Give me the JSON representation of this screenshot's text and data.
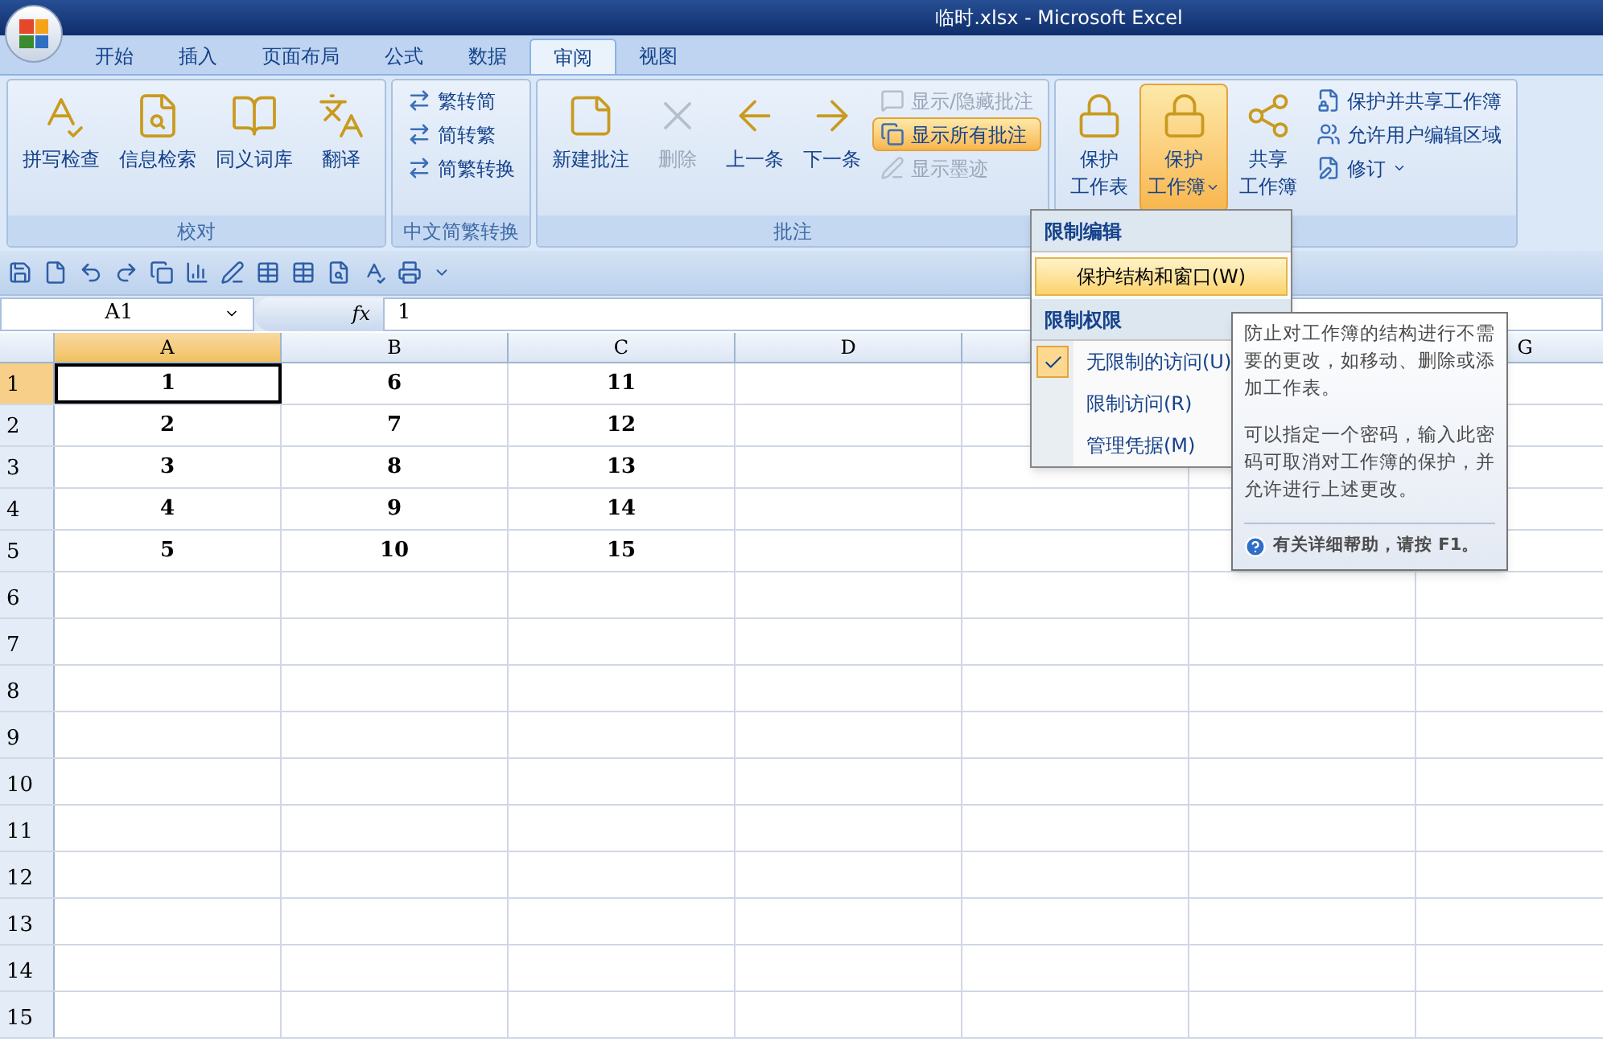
{
  "window": {
    "title": "临时.xlsx - Microsoft Excel"
  },
  "tabs": [
    {
      "label": "开始",
      "selected": false
    },
    {
      "label": "插入",
      "selected": false
    },
    {
      "label": "页面布局",
      "selected": false
    },
    {
      "label": "公式",
      "selected": false
    },
    {
      "label": "数据",
      "selected": false
    },
    {
      "label": "审阅",
      "selected": true
    },
    {
      "label": "视图",
      "selected": false
    }
  ],
  "ribbon_groups": [
    {
      "label": "校对",
      "items": [
        {
          "label": "拼写检查",
          "kind": "large",
          "disabled": false,
          "active": false
        },
        {
          "label": "信息检索",
          "kind": "large",
          "disabled": false,
          "active": false
        },
        {
          "label": "同义词库",
          "kind": "large",
          "disabled": false,
          "active": false
        },
        {
          "label": "翻译",
          "kind": "large",
          "disabled": false,
          "active": false
        }
      ]
    },
    {
      "label": "中文简繁转换",
      "items": [
        {
          "label": "繁转简",
          "kind": "small",
          "disabled": false,
          "active": false
        },
        {
          "label": "简转繁",
          "kind": "small",
          "disabled": false,
          "active": false
        },
        {
          "label": "简繁转换",
          "kind": "small",
          "disabled": false,
          "active": false
        }
      ]
    },
    {
      "label": "批注",
      "items": [
        {
          "label": "新建批注",
          "kind": "large",
          "disabled": false,
          "active": false
        },
        {
          "label": "删除",
          "kind": "large",
          "disabled": true,
          "active": false
        },
        {
          "label": "上一条",
          "kind": "large",
          "disabled": false,
          "active": false
        },
        {
          "label": "下一条",
          "kind": "large",
          "disabled": false,
          "active": false
        },
        {
          "label": "显示/隐藏批注",
          "kind": "small",
          "disabled": true,
          "active": false
        },
        {
          "label": "显示所有批注",
          "kind": "small",
          "disabled": false,
          "active": true
        },
        {
          "label": "显示墨迹",
          "kind": "small",
          "disabled": true,
          "active": false
        }
      ]
    },
    {
      "items": [
        {
          "lines": [
            "保护",
            "工作表"
          ],
          "kind": "large",
          "disabled": false,
          "active": false
        },
        {
          "lines": [
            "保护",
            "工作簿"
          ],
          "kind": "large",
          "disabled": false,
          "active": true,
          "dropdown": true
        },
        {
          "lines": [
            "共享",
            "工作簿"
          ],
          "kind": "large",
          "disabled": false,
          "active": false
        },
        {
          "label": "保护并共享工作簿",
          "kind": "small",
          "disabled": false,
          "active": false
        },
        {
          "label": "允许用户编辑区域",
          "kind": "small",
          "disabled": false,
          "active": false
        },
        {
          "label": "修订",
          "kind": "small",
          "disabled": false,
          "active": false,
          "dropdown": true
        }
      ]
    }
  ],
  "name_box": "A1",
  "formula_bar": {
    "fx": "fx",
    "value": "1"
  },
  "columns": [
    {
      "label": "A",
      "selected": true
    },
    {
      "label": "B",
      "selected": false
    },
    {
      "label": "C",
      "selected": false
    },
    {
      "label": "D",
      "selected": false
    },
    {},
    {},
    {
      "label": "G",
      "selected": false
    }
  ],
  "rows": [
    {
      "label": "1",
      "selected": true,
      "cells": [
        "1",
        "6",
        "11"
      ]
    },
    {
      "label": "2",
      "selected": false,
      "cells": [
        "2",
        "7",
        "12"
      ]
    },
    {
      "label": "3",
      "selected": false,
      "cells": [
        "3",
        "8",
        "13"
      ]
    },
    {
      "label": "4",
      "selected": false,
      "cells": [
        "4",
        "9",
        "14"
      ]
    },
    {
      "label": "5",
      "selected": false,
      "cells": [
        "5",
        "10",
        "15"
      ]
    },
    {
      "label": "6",
      "selected": false,
      "cells": []
    },
    {
      "label": "7",
      "selected": false,
      "cells": []
    },
    {
      "label": "8",
      "selected": false,
      "cells": []
    },
    {
      "label": "9",
      "selected": false,
      "cells": []
    },
    {
      "label": "10",
      "selected": false,
      "cells": []
    },
    {
      "label": "11",
      "selected": false,
      "cells": []
    },
    {
      "label": "12",
      "selected": false,
      "cells": []
    },
    {
      "label": "13",
      "selected": false,
      "cells": []
    },
    {
      "label": "14",
      "selected": false,
      "cells": []
    },
    {
      "label": "15",
      "selected": false,
      "cells": []
    }
  ],
  "dropdown_menu": {
    "sections": [
      {
        "heading": "限制编辑",
        "items": [
          {
            "label": "保护结构和窗口(W)",
            "kind": "plain",
            "selected": true
          }
        ]
      },
      {
        "heading": "限制权限",
        "items": [
          {
            "label": "无限制的访问(U)",
            "kind": "check",
            "selected": false,
            "checked": true
          },
          {
            "label": "限制访问(R)",
            "kind": "check",
            "selected": false,
            "checked": false
          },
          {
            "label": "管理凭据(M)",
            "kind": "check",
            "selected": false,
            "checked": false
          }
        ]
      }
    ]
  },
  "tooltip": {
    "paragraphs": [
      "防止对工作簿的结构进行不需要的更改，如移动、删除或添加工作表。",
      "可以指定一个密码，输入此密码可取消对工作簿的保护，并允许进行上述更改。"
    ],
    "help": "有关详细帮助，请按 F1。"
  }
}
